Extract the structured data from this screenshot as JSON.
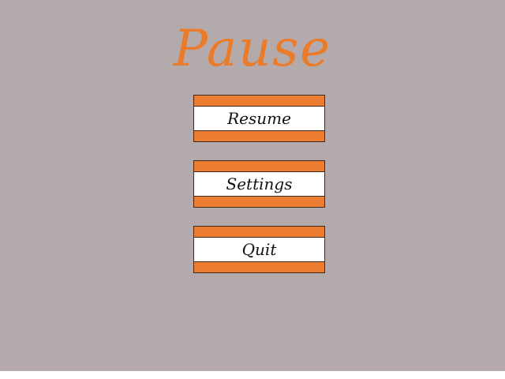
{
  "screen": {
    "title": "Pause",
    "background_color": "#b4aaab",
    "accent_color": "#ed7d31"
  },
  "menu": {
    "resume_label": "Resume",
    "settings_label": "Settings",
    "quit_label": "Quit"
  }
}
